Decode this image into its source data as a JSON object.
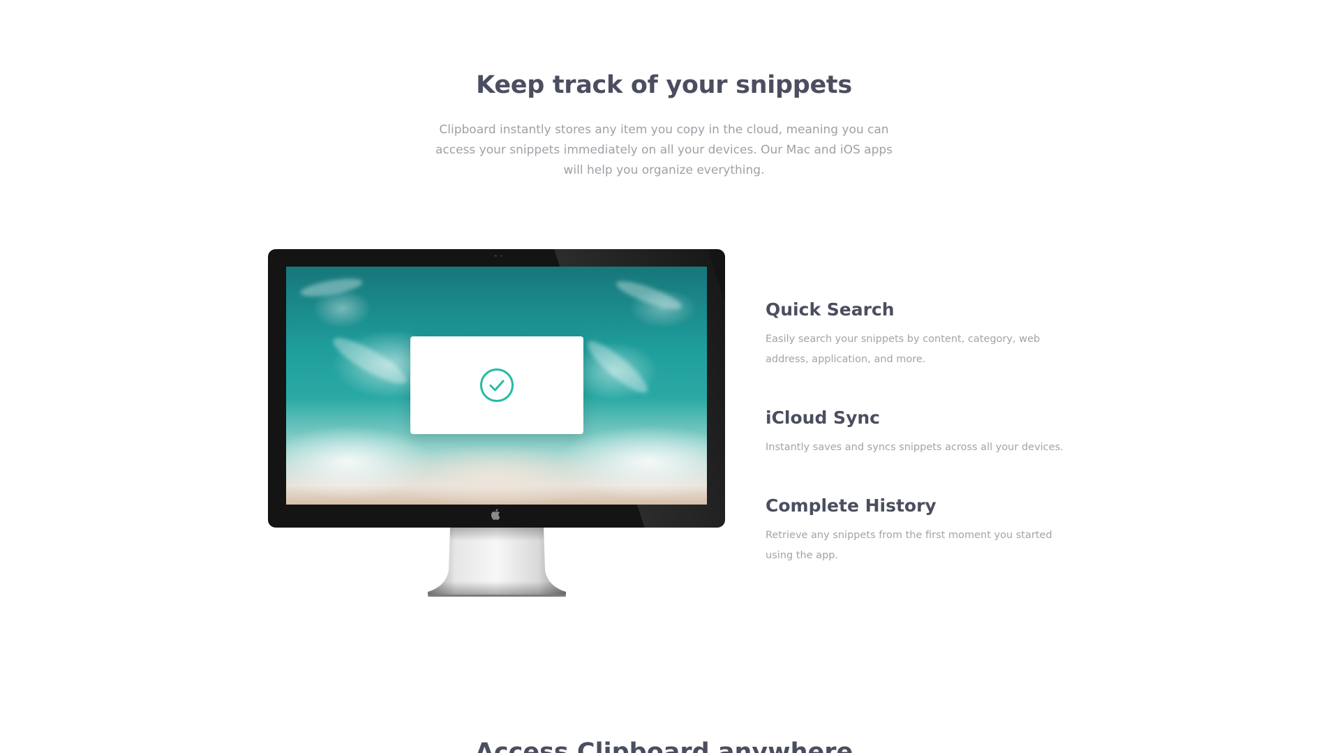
{
  "section": {
    "title": "Keep track of your snippets",
    "description": "Clipboard instantly stores any item you copy in the cloud, meaning you can access your snippets immediately on all your devices. Our Mac and iOS apps will help you organize everything."
  },
  "features": [
    {
      "title": "Quick Search",
      "description": "Easily search your snippets by content, category, web address, application, and more."
    },
    {
      "title": "iCloud Sync",
      "description": "Instantly saves and syncs snippets across all your devices."
    },
    {
      "title": "Complete History",
      "description": "Retrieve any snippets from the first moment you started using the app."
    }
  ],
  "next_section": {
    "title": "Access Clipboard anywhere"
  },
  "icons": {
    "dialog": "check-circle-icon",
    "monitor_logo": "apple-logo-icon"
  },
  "colors": {
    "accent": "#26bba4",
    "heading": "#4b4e5f",
    "body_text": "#9fa0a7"
  }
}
